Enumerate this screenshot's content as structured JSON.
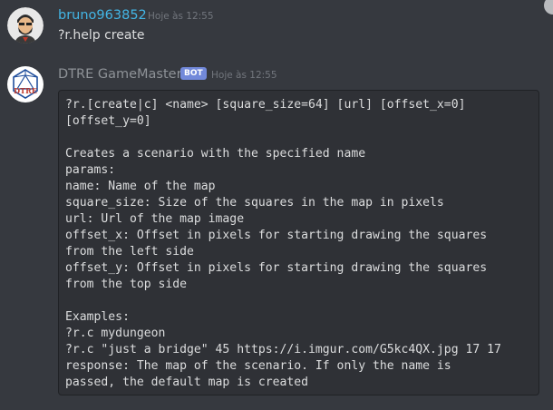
{
  "messages": [
    {
      "username": "bruno963852",
      "username_color": "#43b5e5",
      "timestamp": "Hoje às 12:55",
      "text": "?r.help create",
      "avatar_icon": "bearded-man-avatar"
    },
    {
      "username": "DTRE GameMaster",
      "username_color": "#8e9297",
      "badge": "BOT",
      "timestamp": "Hoje às 12:55",
      "avatar_icon": "d20-dice-logo",
      "avatar_text": "DTRE",
      "code": "?r.[create|c] <name> [square_size=64] [url] [offset_x=0]\n[offset_y=0]\n\nCreates a scenario with the specified name\nparams:\nname: Name of the map\nsquare_size: Size of the squares in the map in pixels\nurl: Url of the map image\noffset_x: Offset in pixels for starting drawing the squares\nfrom the left side\noffset_y: Offset in pixels for starting drawing the squares\nfrom the top side\n\nExamples:\n?r.c mydungeon\n?r.c \"just a bridge\" 45 https://i.imgur.com/G5kc4QX.jpg 17 17\nresponse: The map of the scenario. If only the name is\npassed, the default map is created"
    }
  ],
  "colors": {
    "background": "#36393f",
    "codeblock_bg": "#2f3136",
    "bot_badge": "#7289da"
  }
}
